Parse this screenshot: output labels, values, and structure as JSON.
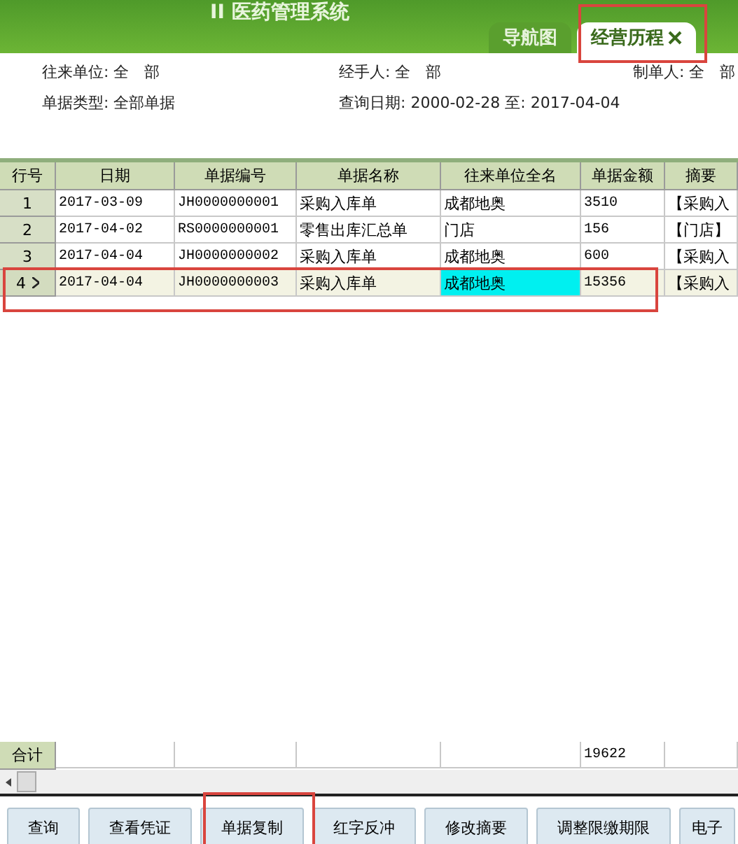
{
  "header": {
    "title": "II 医药管理系统"
  },
  "tabs": [
    {
      "label": "导航图",
      "selected": false,
      "closable": false
    },
    {
      "label": "经营历程",
      "selected": true,
      "closable": true
    }
  ],
  "filters": [
    [
      {
        "label": "往来单位:",
        "value": "全　部"
      },
      {
        "label": "经手人:",
        "value": "全　部"
      },
      {
        "label": "制单人:",
        "value": "全　部"
      }
    ],
    [
      {
        "label": "单据类型:",
        "value": "全部单据"
      },
      {
        "label": "查询日期:",
        "value": "2000-02-28 至: 2017-04-04"
      }
    ]
  ],
  "table": {
    "columns": [
      "行号",
      "日期",
      "单据编号",
      "单据名称",
      "往来单位全名",
      "单据金额",
      "摘要"
    ],
    "rows": [
      {
        "no": "1",
        "date": "2017-03-09",
        "number": "JH0000000001",
        "name": "采购入库单",
        "partner": "成都地奥",
        "amount": "3510",
        "summary": "【采购入",
        "selected": false,
        "partner_focused": false
      },
      {
        "no": "2",
        "date": "2017-04-02",
        "number": "RS0000000001",
        "name": "零售出库汇总单",
        "partner": "门店",
        "amount": "156",
        "summary": "【门店】",
        "selected": false,
        "partner_focused": false
      },
      {
        "no": "3",
        "date": "2017-04-04",
        "number": "JH0000000002",
        "name": "采购入库单",
        "partner": "成都地奥",
        "amount": "600",
        "summary": "【采购入",
        "selected": false,
        "partner_focused": false
      },
      {
        "no": "4",
        "date": "2017-04-04",
        "number": "JH0000000003",
        "name": "采购入库单",
        "partner": "成都地奥",
        "amount": "15356",
        "summary": "【采购入",
        "selected": true,
        "partner_focused": true
      }
    ],
    "total": {
      "label": "合计",
      "amount": "19622"
    }
  },
  "buttons": [
    "查询",
    "查看凭证",
    "单据复制",
    "红字反冲",
    "修改摘要",
    "调整限缴期限",
    "电子"
  ]
}
